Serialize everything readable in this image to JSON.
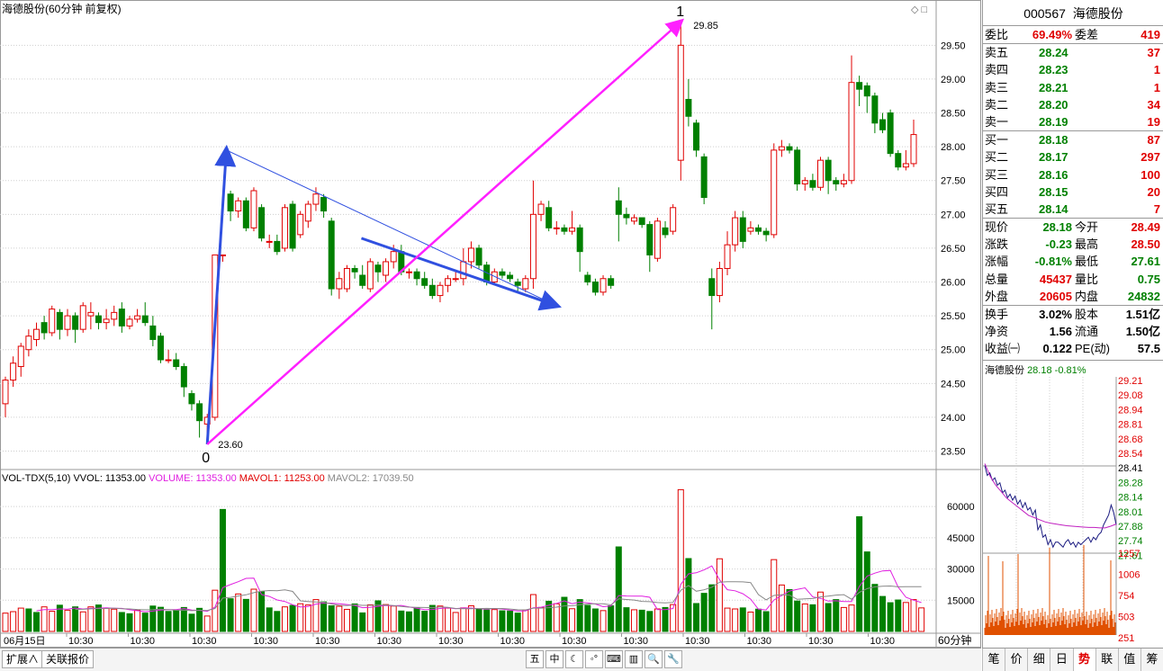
{
  "window": {
    "title": "海德股份(60分钟 前复权)",
    "corner_icons": "◇ □"
  },
  "main_chart": {
    "price_axis": [
      "29.50",
      "29.00",
      "28.50",
      "28.00",
      "27.50",
      "27.00",
      "26.50",
      "26.00",
      "25.50",
      "25.00",
      "24.50",
      "24.00",
      "23.50"
    ],
    "wave_labels": {
      "zero": "0",
      "one": "1"
    },
    "high_label": "29.85",
    "low_label": "23.60",
    "date_label": "06月15日",
    "time_labels": [
      "10:30",
      "10:30",
      "10:30",
      "10:30",
      "10:30",
      "10:30",
      "10:30",
      "10:30",
      "10:30",
      "10:30",
      "10:30",
      "10:30",
      "10:30",
      "10:30"
    ]
  },
  "volume_panel": {
    "indicator_name": "VOL-TDX(5,10)",
    "vvol": "VVOL: 11353.00",
    "volume": "VOLUME: 11353.00",
    "mavol1": "MAVOL1: 11253.00",
    "mavol2": "MAVOL2: 17039.50",
    "axis": [
      "60000",
      "45000",
      "30000",
      "15000"
    ],
    "period": "60分钟"
  },
  "chart_data": {
    "type": "candlestick",
    "title": "海德股份(60分钟 前复权)",
    "ylim": [
      23.3,
      30.0
    ],
    "annotations": {
      "wave_low": 23.6,
      "wave_high": 29.85
    },
    "candles": [
      [
        24.2,
        24.55,
        24.0,
        24.6
      ],
      [
        24.55,
        24.8,
        24.45,
        24.9
      ],
      [
        24.75,
        25.05,
        24.6,
        25.1
      ],
      [
        25.0,
        25.2,
        24.9,
        25.3
      ],
      [
        25.15,
        25.3,
        25.05,
        25.4
      ],
      [
        25.4,
        25.25,
        25.15,
        25.5
      ],
      [
        25.25,
        25.6,
        25.2,
        25.65
      ],
      [
        25.55,
        25.3,
        25.15,
        25.6
      ],
      [
        25.3,
        25.5,
        25.2,
        25.6
      ],
      [
        25.5,
        25.3,
        25.1,
        25.55
      ],
      [
        25.3,
        25.65,
        25.25,
        25.7
      ],
      [
        25.5,
        25.55,
        25.3,
        25.7
      ],
      [
        25.5,
        25.4,
        25.3,
        25.55
      ],
      [
        25.4,
        25.45,
        25.3,
        25.6
      ],
      [
        25.45,
        25.55,
        25.35,
        25.65
      ],
      [
        25.6,
        25.35,
        25.25,
        25.7
      ],
      [
        25.35,
        25.45,
        25.3,
        25.5
      ],
      [
        25.45,
        25.5,
        25.4,
        25.6
      ],
      [
        25.5,
        25.4,
        25.35,
        25.7
      ],
      [
        25.35,
        25.15,
        25.05,
        25.5
      ],
      [
        25.2,
        24.85,
        24.8,
        25.25
      ],
      [
        24.85,
        24.85,
        24.8,
        25.0
      ],
      [
        24.85,
        24.75,
        24.7,
        24.95
      ],
      [
        24.75,
        24.45,
        24.3,
        24.8
      ],
      [
        24.35,
        24.2,
        24.1,
        24.4
      ],
      [
        24.2,
        23.95,
        23.7,
        24.25
      ],
      [
        23.9,
        24.0,
        23.6,
        24.05
      ],
      [
        24.0,
        26.4,
        23.95,
        26.4
      ],
      [
        26.4,
        26.4,
        26.3,
        26.4
      ],
      [
        27.3,
        27.05,
        26.9,
        27.35
      ],
      [
        27.05,
        27.2,
        26.95,
        27.25
      ],
      [
        27.2,
        26.8,
        26.75,
        27.25
      ],
      [
        26.8,
        27.35,
        26.75,
        27.4
      ],
      [
        27.1,
        26.65,
        26.6,
        27.15
      ],
      [
        26.6,
        26.6,
        26.5,
        26.7
      ],
      [
        26.6,
        26.45,
        26.4,
        26.7
      ],
      [
        26.5,
        27.1,
        26.45,
        27.15
      ],
      [
        27.15,
        26.5,
        26.45,
        27.2
      ],
      [
        26.7,
        27.0,
        26.65,
        27.05
      ],
      [
        26.9,
        27.15,
        26.8,
        27.2
      ],
      [
        27.15,
        27.3,
        27.05,
        27.4
      ],
      [
        27.25,
        27.05,
        26.95,
        27.3
      ],
      [
        26.9,
        25.9,
        25.8,
        26.95
      ],
      [
        25.9,
        26.05,
        25.75,
        26.15
      ],
      [
        25.9,
        26.2,
        25.85,
        26.25
      ],
      [
        26.2,
        26.15,
        26.05,
        26.25
      ],
      [
        26.1,
        25.95,
        25.9,
        26.25
      ],
      [
        25.9,
        26.3,
        25.85,
        26.35
      ],
      [
        26.25,
        26.15,
        26.0,
        26.3
      ],
      [
        26.1,
        26.3,
        26.0,
        26.35
      ],
      [
        26.3,
        26.45,
        26.2,
        26.55
      ],
      [
        26.45,
        26.15,
        26.1,
        26.55
      ],
      [
        26.15,
        26.15,
        26.05,
        26.2
      ],
      [
        26.15,
        26.05,
        25.95,
        26.2
      ],
      [
        26.05,
        25.95,
        25.9,
        26.15
      ],
      [
        25.95,
        25.8,
        25.75,
        26.05
      ],
      [
        25.8,
        25.95,
        25.7,
        26.0
      ],
      [
        25.95,
        26.05,
        25.85,
        26.1
      ],
      [
        26.05,
        26.05,
        26.0,
        26.15
      ],
      [
        26.05,
        26.3,
        25.95,
        26.5
      ],
      [
        26.3,
        26.5,
        26.2,
        26.6
      ],
      [
        26.5,
        26.25,
        26.2,
        26.55
      ],
      [
        26.25,
        26.0,
        25.95,
        26.3
      ],
      [
        26.0,
        26.15,
        25.95,
        26.2
      ],
      [
        26.15,
        26.1,
        26.05,
        26.2
      ],
      [
        26.1,
        26.05,
        26.0,
        26.15
      ],
      [
        26.0,
        25.95,
        25.85,
        26.05
      ],
      [
        25.9,
        26.05,
        25.85,
        26.1
      ],
      [
        26.05,
        27.0,
        25.9,
        27.5
      ],
      [
        27.0,
        27.15,
        26.9,
        27.2
      ],
      [
        27.1,
        26.8,
        26.75,
        27.2
      ],
      [
        26.8,
        26.8,
        26.7,
        26.9
      ],
      [
        26.8,
        26.75,
        26.7,
        26.85
      ],
      [
        26.75,
        26.8,
        26.7,
        27.05
      ],
      [
        26.8,
        26.45,
        26.15,
        26.85
      ],
      [
        26.1,
        26.0,
        25.95,
        26.15
      ],
      [
        26.0,
        25.85,
        25.8,
        26.05
      ],
      [
        25.85,
        26.05,
        25.8,
        26.1
      ],
      [
        26.05,
        25.95,
        25.9,
        26.1
      ],
      [
        27.2,
        27.0,
        26.6,
        27.4
      ],
      [
        27.0,
        26.95,
        26.85,
        27.1
      ],
      [
        26.9,
        26.95,
        26.85,
        27.0
      ],
      [
        26.95,
        26.85,
        26.8,
        26.95
      ],
      [
        26.85,
        26.4,
        26.15,
        26.9
      ],
      [
        26.35,
        26.9,
        26.3,
        26.95
      ],
      [
        26.8,
        26.7,
        26.65,
        26.9
      ],
      [
        26.75,
        27.1,
        26.7,
        27.15
      ],
      [
        27.8,
        29.5,
        27.5,
        29.85
      ],
      [
        28.7,
        28.45,
        28.3,
        29.0
      ],
      [
        28.35,
        27.95,
        27.85,
        28.4
      ],
      [
        27.85,
        27.25,
        27.15,
        27.9
      ],
      [
        26.05,
        25.8,
        25.3,
        26.2
      ],
      [
        25.8,
        26.2,
        25.7,
        26.3
      ],
      [
        26.2,
        26.55,
        26.1,
        26.75
      ],
      [
        26.55,
        26.95,
        26.45,
        27.05
      ],
      [
        26.95,
        26.6,
        26.5,
        27.05
      ],
      [
        26.75,
        26.8,
        26.7,
        26.9
      ],
      [
        26.8,
        26.75,
        26.7,
        26.85
      ],
      [
        26.75,
        26.7,
        26.6,
        26.8
      ],
      [
        26.7,
        27.95,
        26.65,
        28.05
      ],
      [
        27.95,
        28.0,
        27.85,
        28.1
      ],
      [
        28.0,
        27.95,
        27.9,
        28.05
      ],
      [
        27.95,
        27.45,
        27.35,
        28.0
      ],
      [
        27.45,
        27.5,
        27.35,
        27.55
      ],
      [
        27.5,
        27.4,
        27.35,
        27.6
      ],
      [
        27.4,
        27.8,
        27.35,
        27.85
      ],
      [
        27.8,
        27.5,
        27.3,
        27.85
      ],
      [
        27.5,
        27.45,
        27.35,
        27.55
      ],
      [
        27.45,
        27.5,
        27.4,
        27.6
      ],
      [
        27.5,
        28.95,
        27.45,
        29.35
      ],
      [
        28.95,
        28.85,
        28.6,
        29.05
      ],
      [
        28.9,
        28.75,
        28.5,
        28.95
      ],
      [
        28.75,
        28.35,
        28.2,
        28.8
      ],
      [
        28.4,
        28.25,
        28.2,
        28.5
      ],
      [
        28.5,
        27.9,
        27.85,
        28.55
      ],
      [
        27.9,
        27.7,
        27.65,
        27.95
      ],
      [
        27.7,
        27.75,
        27.65,
        27.95
      ],
      [
        27.75,
        28.18,
        27.7,
        28.4
      ]
    ],
    "volume": {
      "mavol1_last": 11253.0,
      "mavol2_last": 17039.5,
      "values": [
        8800,
        9500,
        11200,
        10800,
        9100,
        11800,
        9700,
        12600,
        10200,
        11800,
        9400,
        11800,
        12700,
        11100,
        10700,
        9100,
        8500,
        10200,
        8800,
        12200,
        11600,
        9600,
        10100,
        11500,
        8300,
        11100,
        7400,
        19800,
        58600,
        15700,
        18000,
        15400,
        20300,
        19000,
        11300,
        9600,
        11800,
        12500,
        13300,
        12700,
        15300,
        14200,
        12300,
        12100,
        10600,
        13200,
        8900,
        12800,
        14700,
        12900,
        12200,
        9800,
        9400,
        11300,
        9700,
        12500,
        12200,
        11200,
        9100,
        11300,
        12300,
        10800,
        10300,
        10500,
        9900,
        9800,
        8800,
        10300,
        17700,
        11500,
        14500,
        13300,
        16400,
        10900,
        15300,
        12500,
        10800,
        10000,
        12300,
        40600,
        11400,
        10400,
        10200,
        9600,
        10800,
        11500,
        12900,
        68100,
        35000,
        13400,
        18300,
        22400,
        34900,
        11200,
        10800,
        11300,
        9300,
        10700,
        9500,
        34500,
        22300,
        20100,
        14600,
        13200,
        12800,
        18900,
        13400,
        15300,
        11500,
        12700,
        55100,
        38200,
        22600,
        16800,
        13800,
        15100,
        13900,
        15300,
        11300
      ],
      "down": [
        false,
        false,
        false,
        true,
        true,
        false,
        false,
        true,
        false,
        true,
        false,
        false,
        true,
        false,
        false,
        true,
        true,
        false,
        true,
        true,
        true,
        true,
        true,
        true,
        true,
        true,
        false,
        false,
        true,
        true,
        false,
        true,
        false,
        true,
        true,
        true,
        false,
        true,
        false,
        false,
        false,
        true,
        true,
        false,
        false,
        true,
        true,
        false,
        true,
        false,
        false,
        true,
        true,
        true,
        true,
        true,
        false,
        false,
        false,
        false,
        false,
        true,
        true,
        false,
        true,
        true,
        true,
        false,
        false,
        false,
        true,
        false,
        true,
        false,
        true,
        true,
        true,
        false,
        true,
        true,
        true,
        false,
        true,
        true,
        false,
        true,
        false,
        false,
        true,
        true,
        true,
        true,
        false,
        false,
        false,
        true,
        false,
        true,
        true,
        false,
        false,
        true,
        true,
        false,
        true,
        false,
        true,
        true,
        false,
        false,
        true,
        true,
        true,
        true,
        true,
        true,
        false,
        false
      ]
    }
  },
  "quote": {
    "code": "000567",
    "name": "海德股份",
    "wei_bi_label": "委比",
    "wei_bi": "69.49%",
    "wei_cha_label": "委差",
    "wei_cha": "419",
    "asks": [
      {
        "label": "卖五",
        "price": "28.24",
        "vol": "37"
      },
      {
        "label": "卖四",
        "price": "28.23",
        "vol": "1"
      },
      {
        "label": "卖三",
        "price": "28.21",
        "vol": "1"
      },
      {
        "label": "卖二",
        "price": "28.20",
        "vol": "34"
      },
      {
        "label": "卖一",
        "price": "28.19",
        "vol": "19"
      }
    ],
    "bids": [
      {
        "label": "买一",
        "price": "28.18",
        "vol": "87"
      },
      {
        "label": "买二",
        "price": "28.17",
        "vol": "297"
      },
      {
        "label": "买三",
        "price": "28.16",
        "vol": "100"
      },
      {
        "label": "买四",
        "price": "28.15",
        "vol": "20"
      },
      {
        "label": "买五",
        "price": "28.14",
        "vol": "7"
      }
    ],
    "stats": [
      {
        "l1": "现价",
        "v1": "28.18",
        "c1": "green",
        "l2": "今开",
        "v2": "28.49",
        "c2": "red"
      },
      {
        "l1": "涨跌",
        "v1": "-0.23",
        "c1": "green",
        "l2": "最高",
        "v2": "28.50",
        "c2": "red"
      },
      {
        "l1": "涨幅",
        "v1": "-0.81%",
        "c1": "green",
        "l2": "最低",
        "v2": "27.61",
        "c2": "green"
      },
      {
        "l1": "总量",
        "v1": "45437",
        "c1": "red",
        "l2": "量比",
        "v2": "0.75",
        "c2": "green"
      },
      {
        "l1": "外盘",
        "v1": "20605",
        "c1": "red",
        "l2": "内盘",
        "v2": "24832",
        "c2": "green"
      }
    ],
    "stats2": [
      {
        "l1": "换手",
        "v1": "3.02%",
        "l2": "股本",
        "v2": "1.51亿"
      },
      {
        "l1": "净资",
        "v1": "1.56",
        "l2": "流通",
        "v2": "1.50亿"
      },
      {
        "l1": "收益㈠",
        "v1": "0.122",
        "l2": "PE(动)",
        "v2": "57.5"
      }
    ]
  },
  "mini_chart": {
    "title_name": "海德股份",
    "title_price": "28.18",
    "title_change": "-0.81%",
    "price_axis": [
      "29.21",
      "29.08",
      "28.94",
      "28.81",
      "28.68",
      "28.54",
      "28.41",
      "28.28",
      "28.14",
      "28.01",
      "27.88",
      "27.74",
      "27.61"
    ],
    "vol_axis": [
      "1257",
      "1006",
      "754",
      "503",
      "251"
    ]
  },
  "bottom": {
    "left_tabs": [
      "扩展∧",
      "关联报价"
    ],
    "tools": [
      "五",
      "中",
      "☾",
      "◦°",
      "⌨",
      "▥",
      "🔍",
      "🔧"
    ],
    "right_tabs": [
      "笔",
      "价",
      "细",
      "日",
      "势",
      "联",
      "值",
      "筹"
    ],
    "active_right_tab": "势"
  },
  "colors": {
    "up": "#e00000",
    "down": "#008000",
    "mavol1": "#e020e0",
    "mavol2": "#888888",
    "wave_blue": "#3050e0",
    "wave_magenta": "#ff20ff"
  }
}
